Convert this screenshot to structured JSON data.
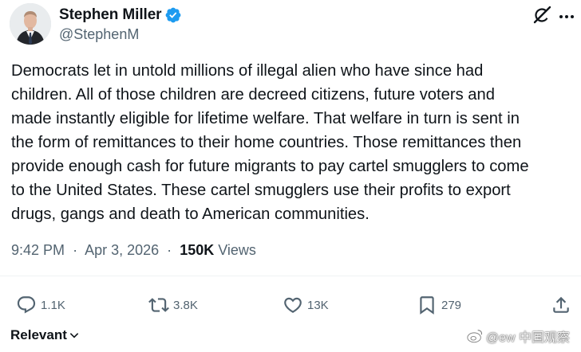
{
  "author": {
    "display_name": "Stephen Miller",
    "handle": "@StephenM",
    "verified": true,
    "verified_color": "#1d9bf0"
  },
  "header_icons": [
    "grok-icon",
    "more-options-icon"
  ],
  "tweet": {
    "text": "Democrats let in untold millions of illegal alien who have since had\nchildren. All of those children are decreed citizens, future voters and\nmade instantly eligible for lifetime welfare. That welfare in turn is sent in\nthe form of remittances to their home countries. Those remittances then\nprovide enough cash for future migrants to pay cartel smugglers to come\nto the United States. These cartel smugglers use their profits to export\ndrugs, gangs and death to American communities.",
    "time": "9:42 PM",
    "date": "Apr 3, 2026",
    "separator": "·",
    "views_count": "150K",
    "views_label": "Views"
  },
  "actions": {
    "replies": "1.1K",
    "reposts": "3.8K",
    "likes": "13K",
    "bookmarks": "279"
  },
  "footer": {
    "sort_label": "Relevant"
  },
  "watermark": {
    "text": "@ew 中国观察"
  },
  "colors": {
    "text_primary": "#0f1419",
    "text_secondary": "#536471",
    "divider": "#eff3f4"
  }
}
